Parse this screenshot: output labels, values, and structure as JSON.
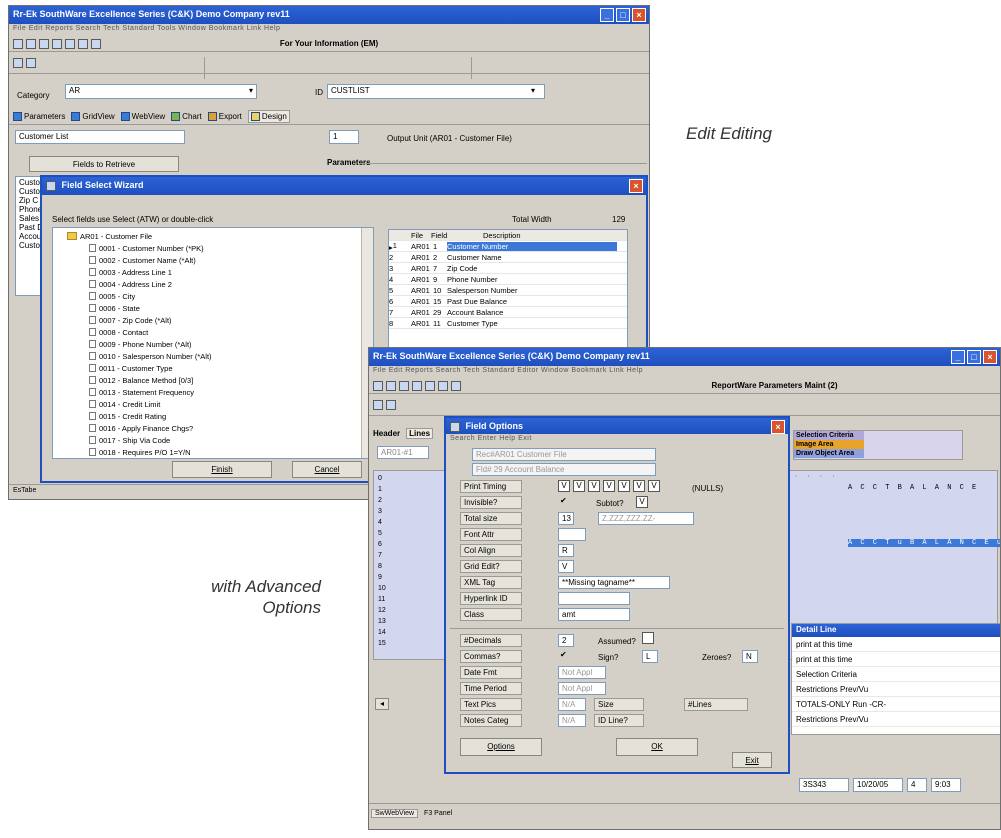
{
  "captions": {
    "edit_editing": "Edit Editing",
    "advanced_line1": "with Advanced",
    "advanced_line2": "Options"
  },
  "colors": {
    "titlebar": "#1e4fbf",
    "selection": "#3c78d8",
    "criteria_header": "#b0a8d8",
    "image_area": "#e8a428",
    "draw_object_area": "#8fa0e0"
  },
  "win1": {
    "title": "Rr-Ek  SouthWare Excellence Series (C&K)     Demo Company rev11",
    "menu": "File  Edit  Reports  Search  Tech  Standard  Tools  Window  Bookmark  Link  Help",
    "toolbar_title": "For Your Information (EM)",
    "category_label": "Category",
    "category_value": "AR",
    "id_label": "ID",
    "id_value": "CUSTLIST",
    "tabs": [
      "Parameters",
      "GridView",
      "WebView",
      "Chart",
      "Export",
      "Design"
    ],
    "report_name": "Customer List",
    "output_num": "1",
    "output_label": "Output Unit (AR01 - Customer File)",
    "fields_button": "Fields to Retrieve",
    "parameters_label": "Parameters",
    "left_list": [
      "Custo",
      "Custo",
      "Zip C",
      "Phone",
      "Sales",
      "Past D",
      "Accou",
      "Custo"
    ],
    "status": "EsTabe"
  },
  "wizard": {
    "title": "Field Select Wizard",
    "instruction": "Select fields use Select (ATW) or double-click",
    "total_width_label": "Total Width",
    "total_width": "129",
    "tree_root": "AR01 - Customer File",
    "tree": [
      "0001 - Customer Number    (*PK)",
      "0002 - Customer Name      (*Alt)",
      "0003 - Address Line 1",
      "0004 - Address Line 2",
      "0005 - City",
      "0006 - State",
      "0007 - Zip Code       (*Alt)",
      "0008 - Contact",
      "0009 - Phone Number      (*Alt)",
      "0010 - Salesperson Number  (*Alt)",
      "0011 - Customer Type",
      "0012 - Balance Method [0/3]",
      "0013 - Statement Frequency",
      "0014 - Credit Limit",
      "0015 - Credit Rating",
      "0016 - Apply Finance Chgs?",
      "0017 - Ship Via Code",
      "0018 - Requires P/O 1=Y/N"
    ],
    "grid_headers": {
      "file": "File",
      "field": "Field",
      "desc": "Description"
    },
    "grid_rows": [
      {
        "n": "1",
        "file": "AR01",
        "field": "1",
        "desc": "Customer Number"
      },
      {
        "n": "2",
        "file": "AR01",
        "field": "2",
        "desc": "Customer Name"
      },
      {
        "n": "3",
        "file": "AR01",
        "field": "7",
        "desc": "Zip Code"
      },
      {
        "n": "4",
        "file": "AR01",
        "field": "9",
        "desc": "Phone Number"
      },
      {
        "n": "5",
        "file": "AR01",
        "field": "10",
        "desc": "Salesperson Number"
      },
      {
        "n": "6",
        "file": "AR01",
        "field": "15",
        "desc": "Past Due Balance"
      },
      {
        "n": "7",
        "file": "AR01",
        "field": "29",
        "desc": "Account Balance"
      },
      {
        "n": "8",
        "file": "AR01",
        "field": "11",
        "desc": "Customer Type"
      }
    ],
    "finish_button": "Finish",
    "cancel_button": "Cancel"
  },
  "win2": {
    "title": "Rr-Ek  SouthWare Excellence Series (C&K)     Demo Company rev11",
    "menu": "File  Edit  Reports  Search  Tech  Standard  Editor  Window  Bookmark  Link  Help",
    "toolbar_title": "ReportWare Parameters Maint (2)",
    "tab_header": "Header",
    "tab_lines": "Lines",
    "left_field": "AR01-#1",
    "legend": [
      "Selection Criteria",
      "Image Area",
      "Draw Object Area"
    ],
    "ruler_row1": "  · · · ·",
    "ruler_row_right": "A C C T   B A L A N C E",
    "ruler_hl_row": "A C C T u B A L A N C E u u u",
    "row_labels": [
      "0",
      "1",
      "2",
      "3",
      "4",
      "5",
      "6",
      "7",
      "8",
      "9",
      "10",
      "11",
      "12",
      "13",
      "14",
      "15"
    ],
    "detail_title": "Detail Line",
    "detail_items": [
      "print at this time",
      "print at this time",
      "Selection Criteria",
      "Restrictions Prev/Vu",
      "TOTALS-ONLY Run -CR-",
      "Restrictions Prev/Vu"
    ],
    "status_fields": [
      "3S343",
      "10/20/05",
      "4",
      "9:03"
    ],
    "bottom_tabs": [
      "SwWebView",
      "F3 Panel"
    ]
  },
  "field_options": {
    "title": "Field Options",
    "menu": "Search  Enter  Help  Exit",
    "file_line": "Rec#AR01 Customer File",
    "field_line": "Fld# 29 Account Balance",
    "print_timing_label": "Print Timing",
    "print_timing_checks": [
      "V",
      "V",
      "V",
      "V",
      "V",
      "V",
      "V"
    ],
    "nulls": "(NULLS)",
    "invisible_label": "Invisible?",
    "invisible_value": "✔",
    "subtot_label": "Subtot?",
    "subtot_value": "V",
    "total_size_label": "Total size",
    "total_size_value": "13",
    "total_size_mask": "Z,ZZZ,ZZZ.ZZ-",
    "font_attr_label": "Font Attr",
    "col_align_label": "Col Align",
    "col_align_value": "R",
    "grid_edit_label": "Grid Edit?",
    "grid_edit_value": "V",
    "xml_tag_label": "XML Tag",
    "xml_tag_value": "**Missing tagname**",
    "hyperlink_label": "Hyperlink ID",
    "class_label": "Class",
    "class_value": "amt",
    "decimals_label": "#Decimals",
    "decimals_value": "2",
    "assumed_label": "Assumed?",
    "commas_label": "Commas?",
    "commas_value": "✔",
    "sign_label": "Sign?",
    "sign_value": "L",
    "zeroes_label": "Zeroes?",
    "zeroes_value": "N",
    "date_fmt_label": "Date Fmt",
    "date_fmt_value": "Not Appl",
    "time_period_label": "Time Period",
    "time_period_value": "Not Appl",
    "text_pics_label": "Text Pics",
    "text_pics_value": "N/A",
    "size_label": "Size",
    "lines_label": "#Lines",
    "notes_categ_label": "Notes Categ",
    "notes_categ_value": "N/A",
    "id_line_label": "ID Line?",
    "options_button": "Options",
    "ok_button": "OK",
    "exit_button": "Exit"
  }
}
